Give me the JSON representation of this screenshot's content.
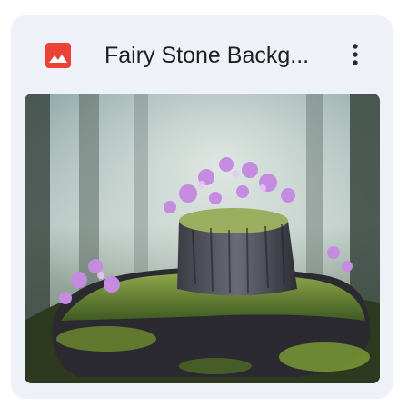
{
  "file_card": {
    "title": "Fairy Stone Backg...",
    "file_type_icon": "image-file-icon",
    "menu_icon": "more-vert-icon",
    "thumbnail_icon": "fairy-stone-thumbnail",
    "colors": {
      "card_background": "#eef2f8",
      "icon_red": "#ea4335",
      "title_text": "#1f1f1f"
    }
  }
}
